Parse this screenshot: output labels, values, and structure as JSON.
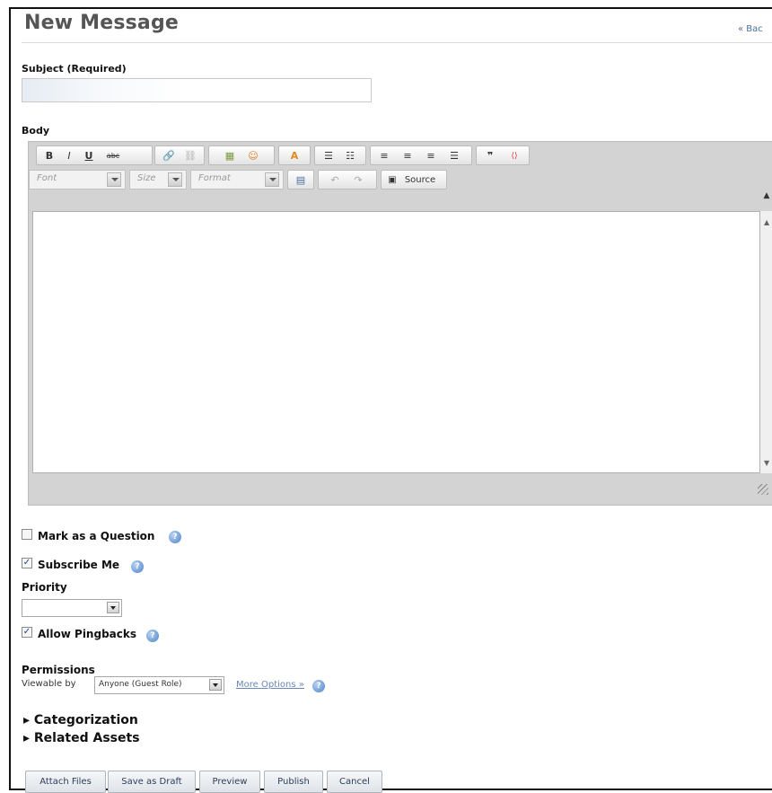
{
  "page": {
    "title": "New Message",
    "back_link": "« Bac"
  },
  "subject": {
    "label": "Subject (Required)",
    "value": ""
  },
  "body": {
    "label": "Body"
  },
  "toolbar": {
    "row1": [
      {
        "icon": "bold-icon",
        "text": "B"
      },
      {
        "icon": "italic-icon",
        "text": "I"
      },
      {
        "icon": "underline-icon",
        "text": "U"
      },
      {
        "icon": "strikethrough-icon",
        "text": "abc"
      },
      {
        "icon": "link-icon",
        "text": "🔗"
      },
      {
        "icon": "unlink-icon",
        "text": "⛓"
      },
      {
        "icon": "image-icon",
        "text": "▦"
      },
      {
        "icon": "emoticon-icon",
        "text": "☺"
      },
      {
        "icon": "text-color-icon",
        "text": "A"
      },
      {
        "icon": "numbered-list-icon",
        "text": "☰"
      },
      {
        "icon": "bulleted-list-icon",
        "text": "☷"
      },
      {
        "icon": "align-left-icon",
        "text": "≡"
      },
      {
        "icon": "align-center-icon",
        "text": "≡"
      },
      {
        "icon": "align-right-icon",
        "text": "≡"
      },
      {
        "icon": "justify-icon",
        "text": "☰"
      },
      {
        "icon": "blockquote-icon",
        "text": "❞"
      },
      {
        "icon": "code-icon",
        "text": "⟨⟩"
      }
    ],
    "font_placeholder": "Font",
    "size_placeholder": "Size",
    "format_placeholder": "Format",
    "source_label": "Source"
  },
  "options": {
    "mark_question_label": "Mark as a Question",
    "mark_question_checked": false,
    "subscribe_label": "Subscribe Me",
    "subscribe_checked": true,
    "priority_label": "Priority",
    "priority_value": "",
    "pingbacks_label": "Allow Pingbacks",
    "pingbacks_checked": true
  },
  "permissions": {
    "label": "Permissions",
    "viewable_by_label": "Viewable by",
    "viewable_by_value": "Anyone (Guest Role)",
    "more_options": "More Options »"
  },
  "sections": {
    "categorization": "Categorization",
    "related_assets": "Related Assets"
  },
  "buttons": {
    "attach_files": "Attach Files",
    "save_draft": "Save as Draft",
    "preview": "Preview",
    "publish": "Publish",
    "cancel": "Cancel"
  }
}
